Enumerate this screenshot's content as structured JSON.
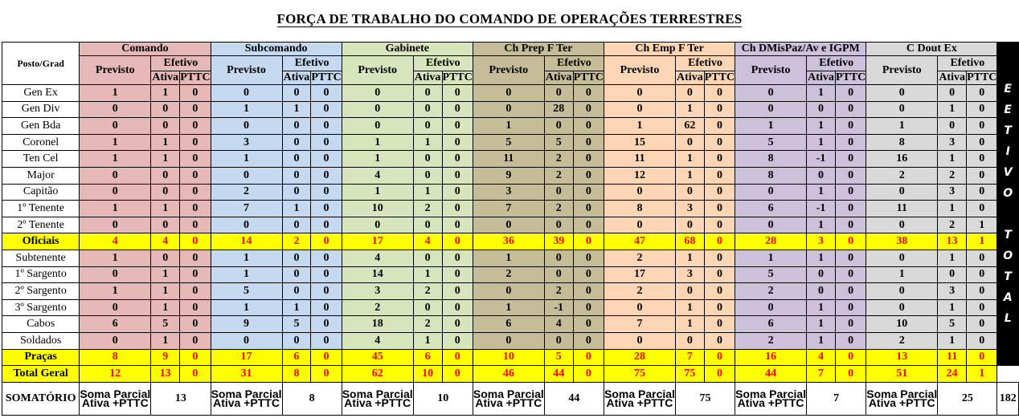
{
  "title": "FORÇA DE TRABALHO DO COMANDO DE OPERAÇÕES TERRESTRES",
  "header": {
    "posto_grad": "Posto/Grad",
    "previsto": "Previsto",
    "efetivo": "Efetivo",
    "ativa": "Ativa",
    "pttc": "PTTC",
    "efetivo_total": [
      "E",
      "E",
      "T",
      "I",
      "V",
      "O",
      "",
      "T",
      "O",
      "T",
      "A",
      "L"
    ]
  },
  "groups": [
    "Comando",
    "Subcomando",
    "Gabinete",
    "Ch Prep F Ter",
    "Ch Emp F Ter",
    "Ch DMisPaz/Av e IGPM",
    "C Dout Ex"
  ],
  "group_colors": [
    "#e6b8b8",
    "#c5d9f1",
    "#d7e4bc",
    "#c4bd97",
    "#fcd5b4",
    "#ccc0da",
    "#d9d9d9"
  ],
  "highlight_color": "#ffff00",
  "highlight_text_color": "#ff0000",
  "rows": [
    {
      "label": "Gen Ex",
      "hl": false,
      "values": [
        "1",
        "1",
        "0",
        "0",
        "0",
        "0",
        "0",
        "0",
        "0",
        "0",
        "0",
        "0",
        "0",
        "0",
        "0",
        "0",
        "1",
        "0",
        "0",
        "0",
        "0"
      ]
    },
    {
      "label": "Gen Div",
      "hl": false,
      "values": [
        "0",
        "0",
        "0",
        "1",
        "1",
        "0",
        "0",
        "0",
        "0",
        "0",
        "28",
        "0",
        "0",
        "1",
        "0",
        "0",
        "0",
        "0",
        "0",
        "1",
        "0"
      ]
    },
    {
      "label": "Gen Bda",
      "hl": false,
      "values": [
        "0",
        "0",
        "0",
        "0",
        "0",
        "0",
        "0",
        "0",
        "0",
        "1",
        "0",
        "0",
        "1",
        "62",
        "0",
        "1",
        "1",
        "0",
        "1",
        "0",
        "0"
      ]
    },
    {
      "label": "Coronel",
      "hl": false,
      "values": [
        "1",
        "1",
        "0",
        "3",
        "0",
        "0",
        "1",
        "1",
        "0",
        "5",
        "5",
        "0",
        "15",
        "0",
        "0",
        "5",
        "1",
        "0",
        "8",
        "3",
        "0"
      ]
    },
    {
      "label": "Ten Cel",
      "hl": false,
      "values": [
        "1",
        "1",
        "0",
        "1",
        "0",
        "0",
        "1",
        "0",
        "0",
        "11",
        "2",
        "0",
        "11",
        "1",
        "0",
        "8",
        "-1",
        "0",
        "16",
        "1",
        "0"
      ]
    },
    {
      "label": "Major",
      "hl": false,
      "values": [
        "0",
        "0",
        "0",
        "0",
        "0",
        "0",
        "4",
        "0",
        "0",
        "9",
        "2",
        "0",
        "12",
        "1",
        "0",
        "8",
        "0",
        "0",
        "2",
        "2",
        "0"
      ]
    },
    {
      "label": "Capitão",
      "hl": false,
      "values": [
        "0",
        "0",
        "0",
        "2",
        "0",
        "0",
        "1",
        "1",
        "0",
        "3",
        "0",
        "0",
        "0",
        "0",
        "0",
        "0",
        "1",
        "0",
        "0",
        "3",
        "0"
      ]
    },
    {
      "label": "1º Tenente",
      "hl": false,
      "values": [
        "1",
        "1",
        "0",
        "7",
        "1",
        "0",
        "10",
        "2",
        "0",
        "7",
        "2",
        "0",
        "8",
        "3",
        "0",
        "6",
        "-1",
        "0",
        "11",
        "1",
        "0"
      ]
    },
    {
      "label": "2º Tenente",
      "hl": false,
      "values": [
        "0",
        "0",
        "0",
        "0",
        "0",
        "0",
        "0",
        "0",
        "0",
        "0",
        "0",
        "0",
        "0",
        "0",
        "0",
        "0",
        "1",
        "0",
        "0",
        "2",
        "1"
      ]
    },
    {
      "label": "Oficiais",
      "hl": true,
      "values": [
        "4",
        "4",
        "0",
        "14",
        "2",
        "0",
        "17",
        "4",
        "0",
        "36",
        "39",
        "0",
        "47",
        "68",
        "0",
        "28",
        "3",
        "0",
        "38",
        "13",
        "1"
      ]
    },
    {
      "label": "Subtenente",
      "hl": false,
      "values": [
        "1",
        "0",
        "0",
        "1",
        "0",
        "0",
        "4",
        "0",
        "0",
        "1",
        "0",
        "0",
        "2",
        "1",
        "0",
        "1",
        "1",
        "0",
        "0",
        "1",
        "0"
      ]
    },
    {
      "label": "1º Sargento",
      "hl": false,
      "values": [
        "0",
        "1",
        "0",
        "1",
        "0",
        "0",
        "14",
        "1",
        "0",
        "2",
        "0",
        "0",
        "17",
        "3",
        "0",
        "5",
        "0",
        "0",
        "1",
        "0",
        "0"
      ]
    },
    {
      "label": "2º Sargento",
      "hl": false,
      "values": [
        "1",
        "1",
        "0",
        "5",
        "0",
        "0",
        "3",
        "2",
        "0",
        "0",
        "2",
        "0",
        "2",
        "0",
        "0",
        "2",
        "0",
        "0",
        "0",
        "3",
        "0"
      ]
    },
    {
      "label": "3º Sargento",
      "hl": false,
      "values": [
        "0",
        "1",
        "0",
        "1",
        "1",
        "0",
        "2",
        "0",
        "0",
        "1",
        "-1",
        "0",
        "0",
        "1",
        "0",
        "0",
        "1",
        "0",
        "0",
        "1",
        "0"
      ]
    },
    {
      "label": "Cabos",
      "hl": false,
      "values": [
        "6",
        "5",
        "0",
        "9",
        "5",
        "0",
        "18",
        "2",
        "0",
        "6",
        "4",
        "0",
        "7",
        "1",
        "0",
        "6",
        "1",
        "0",
        "10",
        "5",
        "0"
      ]
    },
    {
      "label": "Soldados",
      "hl": false,
      "values": [
        "0",
        "1",
        "0",
        "0",
        "0",
        "0",
        "4",
        "1",
        "0",
        "0",
        "0",
        "0",
        "0",
        "0",
        "0",
        "2",
        "1",
        "0",
        "2",
        "1",
        "0"
      ]
    },
    {
      "label": "Praças",
      "hl": true,
      "values": [
        "8",
        "9",
        "0",
        "17",
        "6",
        "0",
        "45",
        "6",
        "0",
        "10",
        "5",
        "0",
        "28",
        "7",
        "0",
        "16",
        "4",
        "0",
        "13",
        "11",
        "0"
      ]
    },
    {
      "label": "Total Geral",
      "hl": true,
      "values": [
        "12",
        "13",
        "0",
        "31",
        "8",
        "0",
        "62",
        "10",
        "0",
        "46",
        "44",
        "0",
        "75",
        "75",
        "0",
        "44",
        "7",
        "0",
        "51",
        "24",
        "1"
      ]
    }
  ],
  "somatorio": {
    "label": "SOMATÓRIO",
    "parcial_line1": "Soma Parcial",
    "parcial_line2": "Ativa +PTTC",
    "values": [
      "13",
      "8",
      "10",
      "44",
      "75",
      "7",
      "25"
    ],
    "total": "182"
  }
}
